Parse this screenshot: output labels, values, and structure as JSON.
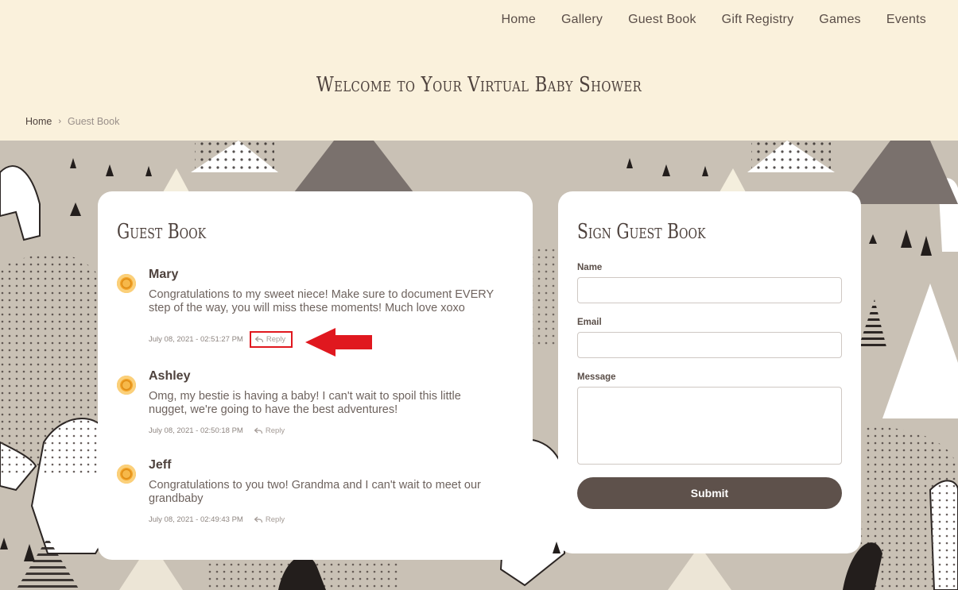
{
  "nav": {
    "items": [
      "Home",
      "Gallery",
      "Guest Book",
      "Gift Registry",
      "Games",
      "Events"
    ]
  },
  "site": {
    "title": "Welcome to Your Virtual Baby Shower"
  },
  "breadcrumb": {
    "home": "Home",
    "separator": "›",
    "current": "Guest Book"
  },
  "guestbook": {
    "title": "Guest Book",
    "reply_label": "Reply",
    "comments": [
      {
        "name": "Mary",
        "text": "Congratulations to my sweet niece! Make sure to document EVERY step of the way, you will miss these moments! Much love xoxo",
        "date": "July 08, 2021 - 02:51:27 PM"
      },
      {
        "name": "Ashley",
        "text": "Omg, my bestie is having a baby! I can't wait to spoil this little nugget, we're going to have the best adventures!",
        "date": "July 08, 2021 - 02:50:18 PM"
      },
      {
        "name": "Jeff",
        "text": "Congratulations to you two! Grandma and I can't wait to meet our grandbaby",
        "date": "July 08, 2021 - 02:49:43 PM"
      }
    ]
  },
  "form": {
    "title": "Sign Guest Book",
    "name_label": "Name",
    "name_value": "",
    "email_label": "Email",
    "email_value": "",
    "message_label": "Message",
    "message_value": "",
    "submit_label": "Submit"
  },
  "colors": {
    "header_bg": "#faf1dc",
    "pattern_bg": "#c9c1b5",
    "accent": "#5e514b",
    "highlight": "#e0181f"
  }
}
